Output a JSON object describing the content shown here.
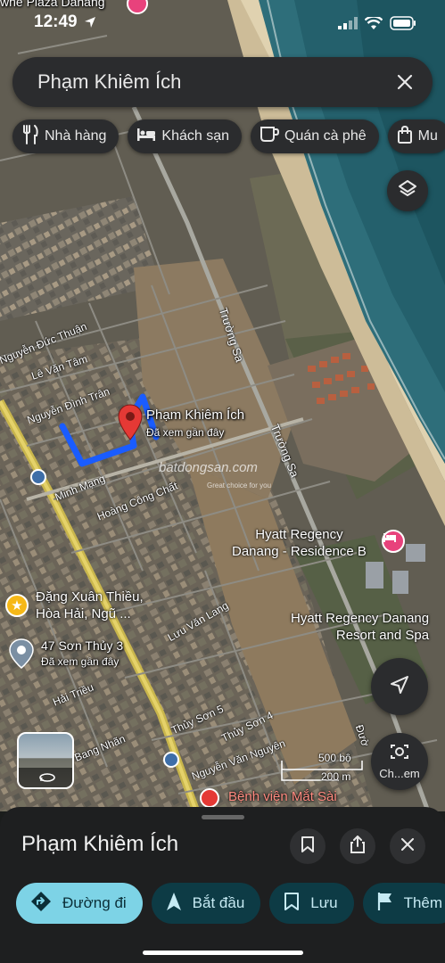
{
  "status_bar": {
    "time": "12:49"
  },
  "search": {
    "query": "Phạm Khiêm Ích"
  },
  "chips": [
    {
      "label": "Nhà hàng",
      "icon": "fork-knife-icon"
    },
    {
      "label": "Khách sạn",
      "icon": "bed-icon"
    },
    {
      "label": "Quán cà phê",
      "icon": "coffee-cup-icon"
    },
    {
      "label": "Mu",
      "icon": "shopping-bag-icon"
    }
  ],
  "map": {
    "top_partial_label": "whe Plaza Danang",
    "pin_title": "Phạm Khiêm Ích",
    "pin_subtitle": "Đã xem gần đây",
    "watermark": "batdongsan.com",
    "watermark_sub": "Great choice for you",
    "roads": {
      "nguyen_duc_thuan": "Nguyễn Đức Thuận",
      "le_van_tam": "Lê Văn Tâm",
      "nguyen_dinh_tran": "Nguyễn Đình Trân",
      "truong_sa_1": "Trường Sa",
      "truong_sa_2": "Trường Sa",
      "minh_mang": "Minh Mạng",
      "hoang_cong_chat": "Hoàng Công Chất",
      "luu_van_lang": "Lưu Văn Lang",
      "hai_trieu": "Hải Triều",
      "thuy_son_5": "Thủy Sơn 5",
      "thuy_son_4": "Thủy Sơn 4",
      "nguyen_van_nguyen": "Nguyễn Văn Nguyên",
      "bang_nhan": "Bang Nhãn",
      "duong_partial": "Đườ"
    },
    "pois": {
      "hyatt_residence": "Hyatt Regency\nDanang - Residence B",
      "hyatt_resort": "Hyatt Regency Danang\nResort and Spa",
      "dang_xuan_thieu": "Đặng Xuân Thiều,\nHòa Hải, Ngũ ...",
      "son_thuy_3": "47 Sơn Thủy 3",
      "son_thuy_3_sub": "Đã xem gần đây",
      "benh_vien": "Bệnh viện Mắt Sài"
    },
    "scale": {
      "top": "500 bộ",
      "bottom": "200 m"
    },
    "lens_label": "Ch...em"
  },
  "sheet": {
    "title": "Phạm Khiêm Ích",
    "actions": [
      {
        "label": "Đường đi",
        "icon": "directions-icon"
      },
      {
        "label": "Bắt đầu",
        "icon": "navigation-arrow-icon"
      },
      {
        "label": "Lưu",
        "icon": "bookmark-icon"
      },
      {
        "label": "Thêm",
        "icon": "flag-icon"
      }
    ]
  },
  "colors": {
    "accent": "#7dd3e6",
    "route_blue": "#1a5cff",
    "pin_red": "#e53935",
    "poi_pink": "#e8427c"
  }
}
